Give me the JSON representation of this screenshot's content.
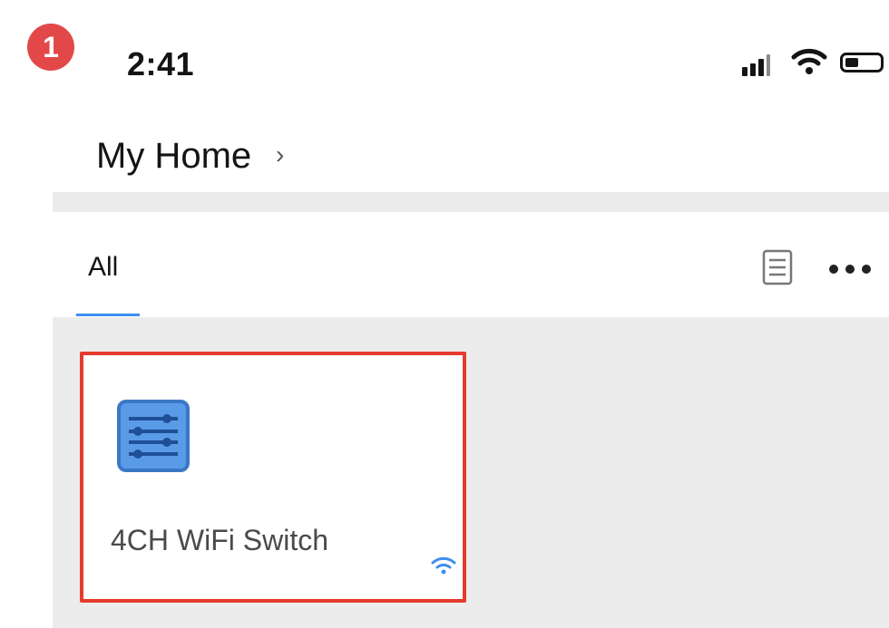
{
  "step_badge": "1",
  "status_bar": {
    "time": "2:41",
    "icons": [
      "signal-icon",
      "wifi-icon",
      "battery-icon"
    ]
  },
  "header": {
    "home_name": "My Home",
    "chevron": "›"
  },
  "tabs": {
    "active_label": "All",
    "active_color": "#3d8ef0",
    "actions": [
      "list-view-icon",
      "more-icon"
    ]
  },
  "devices": [
    {
      "name": "4CH WiFi Switch",
      "icon": "multi-switch-icon",
      "status_icon": "wifi-online-icon",
      "highlight_color": "#e63b2e"
    }
  ]
}
